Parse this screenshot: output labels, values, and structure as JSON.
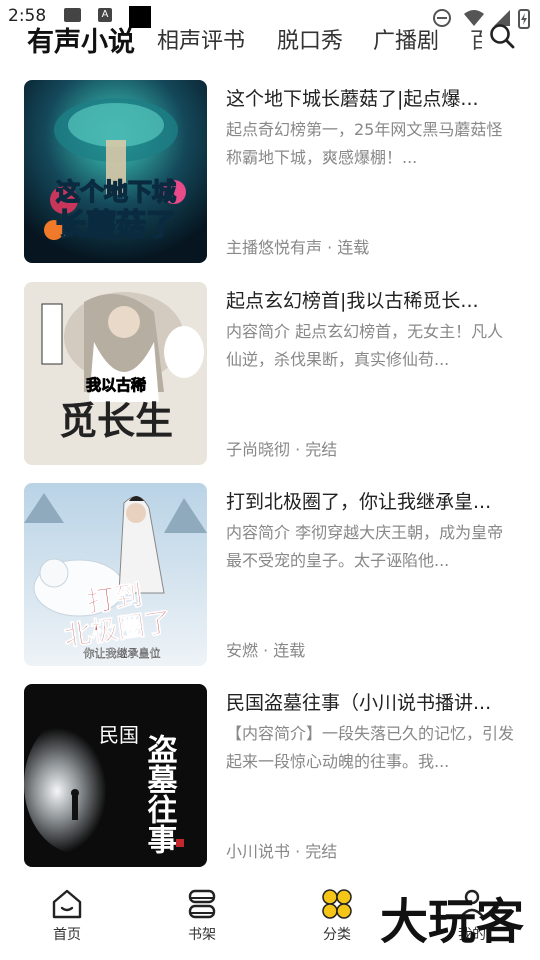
{
  "status_bar": {
    "time": "2:58"
  },
  "top_tabs": [
    {
      "label": "有声小说",
      "active": true
    },
    {
      "label": "相声评书",
      "active": false
    },
    {
      "label": "脱口秀",
      "active": false
    },
    {
      "label": "广播剧",
      "active": false
    },
    {
      "label": "百",
      "active": false
    }
  ],
  "books": [
    {
      "title": "这个地下城长蘑菇了|起点爆...",
      "desc": "起点奇幻榜第一，25年网文黑马蘑菇怪称霸地下城，爽感爆棚！...",
      "meta": "主播悠悦有声 · 连载",
      "cover_text": [
        "这个地下城",
        "长蘑菇了"
      ],
      "cover_palette": [
        "#0d2a3f",
        "#2fa3a0",
        "#e84a8a"
      ]
    },
    {
      "title": "起点玄幻榜首|我以古稀觅长...",
      "desc": "内容简介 起点玄幻榜首，无女主！凡人仙逆，杀伐果断，真实修仙苟...",
      "meta": "子尚晓彻 · 完结",
      "cover_text": [
        "我以古稀",
        "觅长生"
      ],
      "cover_palette": [
        "#e9e4dc",
        "#8a8075",
        "#c23127"
      ]
    },
    {
      "title": "打到北极圈了，你让我继承皇...",
      "desc": "内容简介 李彻穿越大庆王朝，成为皇帝最不受宠的皇子。太子诬陷他...",
      "meta": "安燃 · 连载",
      "cover_text": [
        "打到",
        "北极圈了",
        "你让我继承皇位"
      ],
      "cover_palette": [
        "#cfe1ee",
        "#f5f7f9",
        "#c1272d"
      ]
    },
    {
      "title": "民国盗墓往事（小川说书播讲...",
      "desc": "【内容简介】一段失落已久的记忆，引发起来一段惊心动魄的往事。我...",
      "meta": "小川说书 · 完结",
      "cover_text": [
        "民国",
        "盗墓往事"
      ],
      "cover_palette": [
        "#0c0c0c",
        "#d9dde0",
        "#ffffff"
      ]
    }
  ],
  "bottom_nav": [
    {
      "label": "首页",
      "icon": "home-icon"
    },
    {
      "label": "书架",
      "icon": "bookshelf-icon"
    },
    {
      "label": "分类",
      "icon": "category-icon"
    },
    {
      "label": "我的",
      "icon": "profile-icon"
    }
  ],
  "watermark": "大玩客",
  "colors": {
    "accent": "#f5c518",
    "text_primary": "#222222",
    "text_secondary": "#888888"
  }
}
